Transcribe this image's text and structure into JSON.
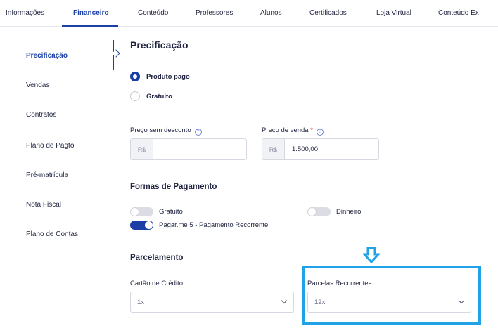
{
  "tabs": [
    {
      "label": "Informações"
    },
    {
      "label": "Financeiro"
    },
    {
      "label": "Conteúdo"
    },
    {
      "label": "Professores"
    },
    {
      "label": "Alunos"
    },
    {
      "label": "Certificados"
    },
    {
      "label": "Loja Virtual"
    },
    {
      "label": "Conteúdo Ex"
    }
  ],
  "active_tab": "Financeiro",
  "sidebar": {
    "items": [
      {
        "label": "Precificação"
      },
      {
        "label": "Vendas"
      },
      {
        "label": "Contratos"
      },
      {
        "label": "Plano de Pagto"
      },
      {
        "label": "Pré-matrícula"
      },
      {
        "label": "Nota Fiscal"
      },
      {
        "label": "Plano de Contas"
      }
    ],
    "active": "Precificação"
  },
  "pricing": {
    "title": "Precificação",
    "options": [
      {
        "label": "Produto pago",
        "selected": true
      },
      {
        "label": "Gratuito",
        "selected": false
      }
    ],
    "price_without_discount": {
      "label": "Preço sem desconto",
      "prefix": "R$",
      "value": ""
    },
    "sale_price": {
      "label": "Preço de venda",
      "required_mark": "*",
      "prefix": "R$",
      "value": "1.500,00"
    },
    "help_glyph": "?"
  },
  "payment_methods": {
    "title": "Formas de Pagamento",
    "toggles": [
      {
        "label": "Gratuito",
        "on": false
      },
      {
        "label": "Dinheiro",
        "on": false
      },
      {
        "label": "Pagar.me 5 - Pagamento Recorrente",
        "on": true
      }
    ]
  },
  "installments": {
    "title": "Parcelamento",
    "credit_card": {
      "label": "Cartão de Crédito",
      "value": "1x"
    },
    "recurring": {
      "label": "Parcelas Recorrentes",
      "value": "12x"
    }
  },
  "colors": {
    "primary": "#1b3fa6",
    "highlight": "#1fa2e6",
    "required": "#e0364a"
  },
  "icons": {
    "help": "help-circle-icon",
    "chevron": "chevron-down-icon",
    "annotation_arrow": "arrow-down-icon"
  }
}
